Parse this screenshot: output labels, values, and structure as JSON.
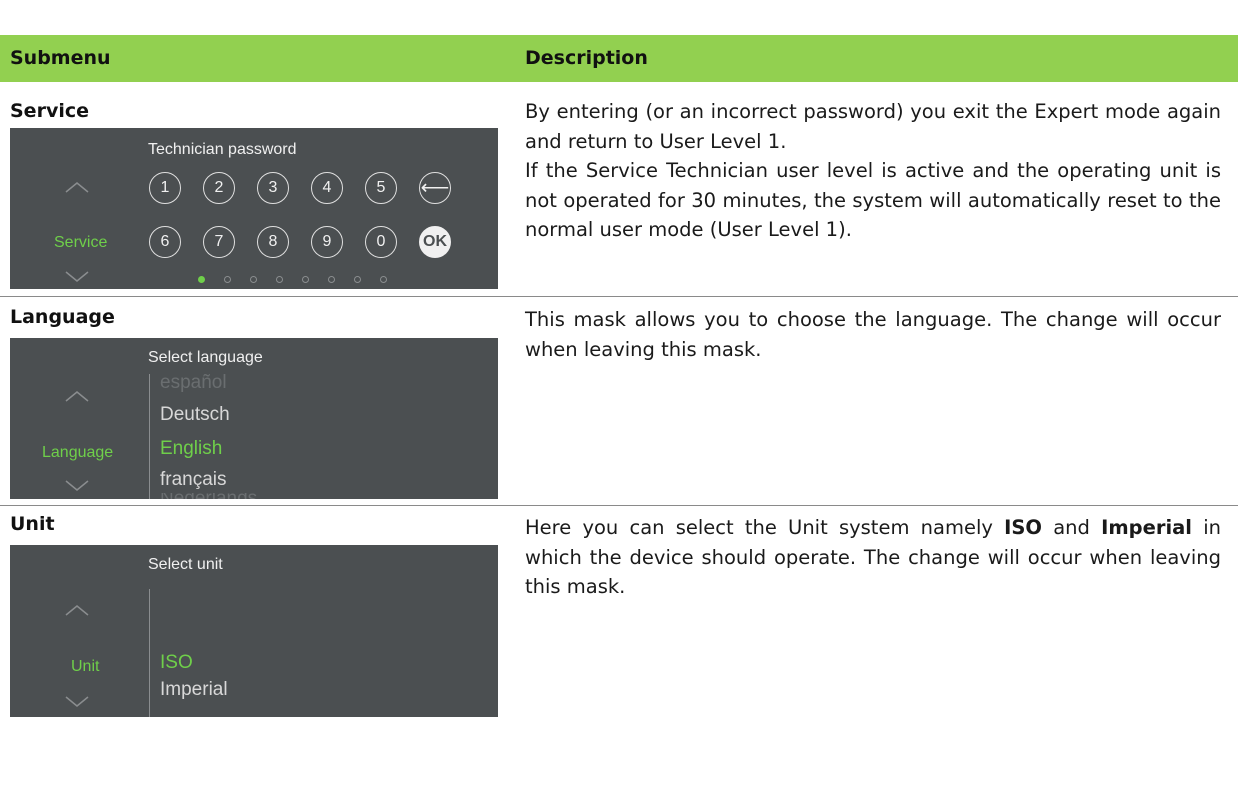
{
  "header": {
    "col1": "Submenu",
    "col2": "Description"
  },
  "rows": [
    {
      "title": "Service",
      "description": [
        "By entering (or an incorrect password) you exit the Expert mode again and return to User Level 1.",
        "If the Service Technician user level is active and the operating unit is not operated for 30 minutes, the system will automatically reset to the normal user mode (User Level 1)."
      ],
      "screen": {
        "title": "Technician password",
        "side_label": "Service",
        "keys_row1": [
          "1",
          "2",
          "3",
          "4",
          "5"
        ],
        "keys_row2": [
          "6",
          "7",
          "8",
          "9",
          "0"
        ],
        "back_key": "⟵",
        "ok_key": "OK",
        "pages": 8,
        "active_page": 1
      }
    },
    {
      "title": "Language",
      "description": "This mask allows you to choose the language. The change will occur when leaving this mask.",
      "screen": {
        "title": "Select language",
        "side_label": "Language",
        "options": [
          "español",
          "Deutsch",
          "English",
          "français",
          "Nederlands"
        ],
        "selected": "English"
      }
    },
    {
      "title": "Unit",
      "description_parts": [
        "Here you can select the Unit system namely ",
        "ISO",
        " and ",
        "Imperial",
        " in which the device should operate. The change will occur when leaving this mask."
      ],
      "screen": {
        "title": "Select unit",
        "side_label": "Unit",
        "options": [
          "ISO",
          "Imperial"
        ],
        "selected": "ISO"
      }
    }
  ],
  "colors": {
    "header_bg": "#92d050",
    "screen_bg": "#4b4f51",
    "accent": "#6fcf4a"
  }
}
